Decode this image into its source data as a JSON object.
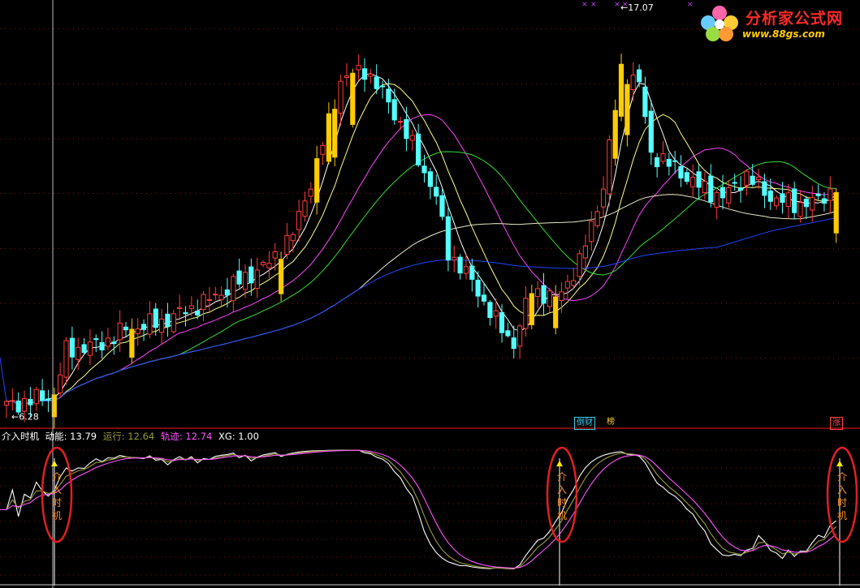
{
  "logo": {
    "name": "分析家公式网",
    "url": "www.88gs.com"
  },
  "price_labels": {
    "low": "6.28",
    "high": "17.07"
  },
  "badges": [
    {
      "text": "倒财",
      "color": "#33ccee"
    },
    {
      "text": "榜",
      "color": "#ffcc33"
    },
    {
      "text": "涨",
      "color": "#ff4444"
    }
  ],
  "indicator": {
    "name": "介入时机",
    "items": [
      {
        "label": "动能: 13.79",
        "color": "#ffffff"
      },
      {
        "label": "运行: 12.64",
        "color": "#9a9a3a"
      },
      {
        "label": "轨迹: 12.74",
        "color": "#ff55ff"
      },
      {
        "label": "XG: 1.00",
        "color": "#ffffff"
      }
    ]
  },
  "signal_label": "介入时机",
  "colors": {
    "up": "#ff3c3c",
    "down": "#54ffff",
    "limit": "#ffcc00",
    "ma5": "#ffffff",
    "ma10": "#ffff88",
    "ma20": "#ff44ff",
    "ma30": "#33dd33",
    "ma60": "#e8e8c8",
    "ma120": "#2244ff",
    "grid": "#8a1414",
    "divider": "#aa1111"
  },
  "chart_data": {
    "type": "candlestick",
    "price_range": [
      5.8,
      17.3
    ],
    "grid_prices": [
      7.6,
      9.1,
      10.6,
      12.1,
      13.6,
      15.1,
      16.6
    ],
    "n_bars": 140,
    "close_keypoints": [
      [
        0,
        6.3
      ],
      [
        8,
        6.6
      ],
      [
        10,
        7.8
      ],
      [
        16,
        8.0
      ],
      [
        20,
        8.4
      ],
      [
        26,
        8.6
      ],
      [
        34,
        9.2
      ],
      [
        44,
        10.2
      ],
      [
        48,
        11.0
      ],
      [
        52,
        12.9
      ],
      [
        56,
        15.2
      ],
      [
        60,
        15.5
      ],
      [
        64,
        14.6
      ],
      [
        68,
        13.4
      ],
      [
        72,
        12.0
      ],
      [
        74,
        10.5
      ],
      [
        78,
        9.7
      ],
      [
        82,
        8.6
      ],
      [
        85,
        8.0
      ],
      [
        88,
        9.5
      ],
      [
        92,
        9.2
      ],
      [
        96,
        10.2
      ],
      [
        100,
        12.3
      ],
      [
        103,
        15.5
      ],
      [
        106,
        15.1
      ],
      [
        108,
        13.2
      ],
      [
        112,
        12.8
      ],
      [
        116,
        12.3
      ],
      [
        120,
        12.0
      ],
      [
        124,
        12.6
      ],
      [
        128,
        12.0
      ],
      [
        132,
        11.8
      ],
      [
        136,
        11.9
      ],
      [
        139,
        12.3
      ]
    ],
    "limit_up_bars": [
      8,
      21,
      46,
      52,
      54,
      55,
      58,
      88,
      92,
      102,
      103,
      104,
      139
    ],
    "signal_bars": [
      8,
      92,
      139
    ],
    "indicator_range": [
      0,
      16
    ],
    "last_values": {
      "动能": 13.79,
      "运行": 12.64,
      "轨迹": 12.74,
      "XG": 1.0
    }
  }
}
